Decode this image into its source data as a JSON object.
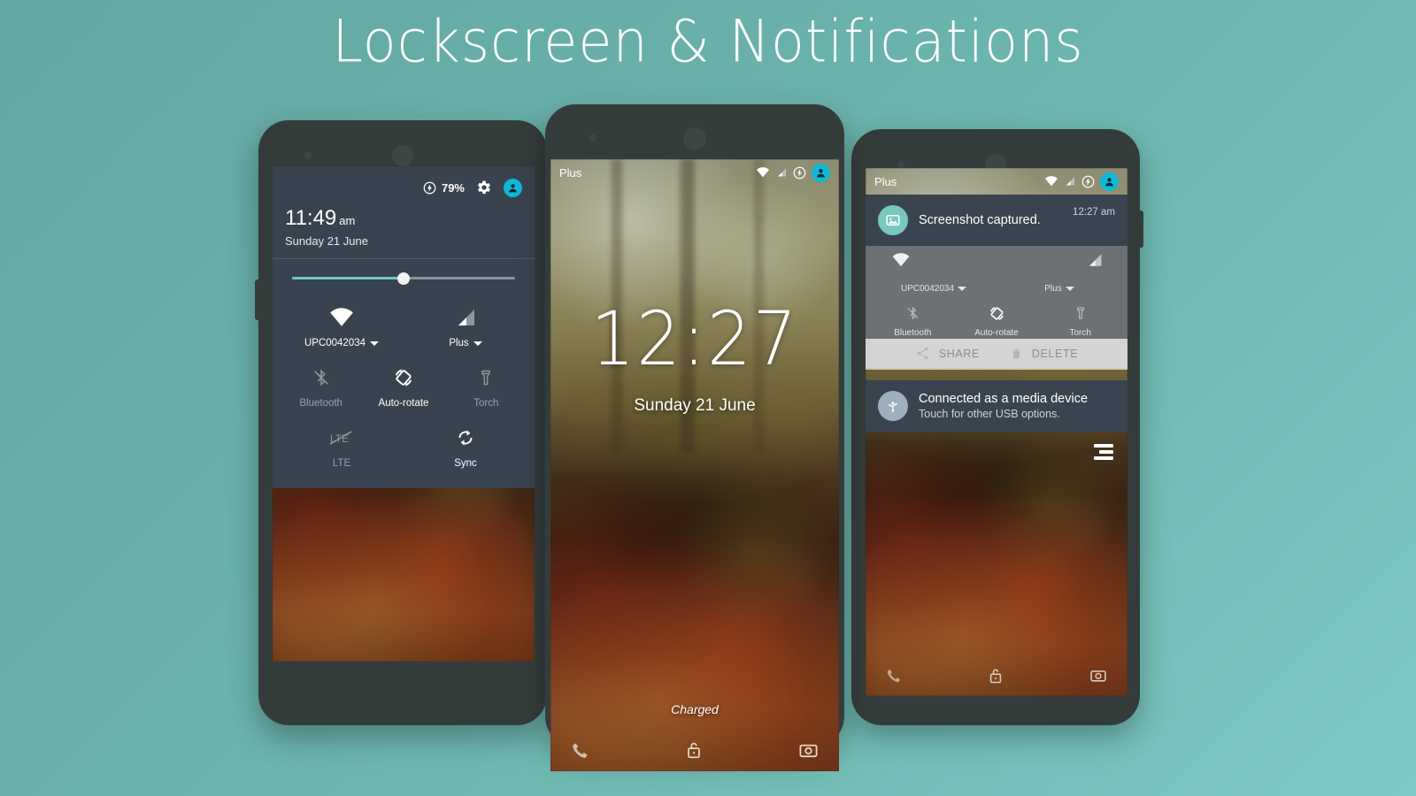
{
  "header": {
    "title": "Lockscreen & Notifications"
  },
  "theme": {
    "background_top": "#63a6a0",
    "background_bottom": "#7cc8c2",
    "panel": "#39434f",
    "accent_cyan": "#0fb9d7",
    "accent_teal": "#6fc9bd",
    "phone_body": "#343c3b"
  },
  "phone_left": {
    "name": "quick-settings-panel",
    "status": {
      "battery_percent": "79%",
      "battery_icon": "battery-charging-icon",
      "settings_icon": "gear-icon",
      "avatar_icon": "user-avatar-icon"
    },
    "clock": {
      "time": "11:49",
      "ampm": "am",
      "date": "Sunday 21 June"
    },
    "brightness": {
      "label": "brightness-slider",
      "value": 50
    },
    "tiles": [
      {
        "label": "UPC0042034",
        "icon": "wifi-icon",
        "has_caret": true,
        "state": "on"
      },
      {
        "label": "Plus",
        "icon": "signal-icon",
        "has_caret": true,
        "state": "on"
      },
      {
        "label": "Bluetooth",
        "icon": "bluetooth-off-icon",
        "has_caret": false,
        "state": "off"
      },
      {
        "label": "Auto-rotate",
        "icon": "auto-rotate-icon",
        "has_caret": false,
        "state": "on"
      },
      {
        "label": "Torch",
        "icon": "torch-icon",
        "has_caret": false,
        "state": "off"
      },
      {
        "label": "LTE",
        "icon": "lte-off-icon",
        "has_caret": false,
        "state": "off"
      },
      {
        "label": "Sync",
        "icon": "sync-icon",
        "has_caret": false,
        "state": "on"
      }
    ]
  },
  "phone_center": {
    "name": "lockscreen",
    "status": {
      "carrier": "Plus",
      "wifi_icon": "wifi-icon",
      "signal_icon": "signal-icon",
      "battery_icon": "battery-charging-icon",
      "avatar_icon": "user-avatar-icon"
    },
    "clock": {
      "time": "12:27",
      "date": "Sunday 21 June"
    },
    "battery_status": "Charged",
    "shortcuts": [
      {
        "label": "phone-shortcut",
        "icon": "phone-icon"
      },
      {
        "label": "unlock",
        "icon": "lock-open-icon"
      },
      {
        "label": "camera-shortcut",
        "icon": "camera-icon"
      }
    ]
  },
  "phone_right": {
    "name": "notification-shade",
    "status": {
      "carrier": "Plus",
      "wifi_icon": "wifi-icon",
      "signal_icon": "signal-icon",
      "battery_icon": "battery-charging-icon",
      "avatar_icon": "user-avatar-icon"
    },
    "notifications": [
      {
        "title": "Screenshot captured.",
        "subtitle": "",
        "time": "12:27 am",
        "icon": "image-icon",
        "icon_color": "#79c8bd"
      },
      {
        "title": "Connected as a media device",
        "subtitle": "Touch for other USB options.",
        "time": "",
        "icon": "usb-icon",
        "icon_color": "#9fb0bd"
      }
    ],
    "screenshot_preview": {
      "tiles": [
        {
          "label": "UPC0042034",
          "icon": "wifi-icon",
          "has_caret": true
        },
        {
          "label": "Plus",
          "icon": "signal-icon",
          "has_caret": true
        },
        {
          "label": "Bluetooth",
          "icon": "bluetooth-off-icon",
          "has_caret": false
        },
        {
          "label": "Auto-rotate",
          "icon": "auto-rotate-icon",
          "has_caret": false
        },
        {
          "label": "Torch",
          "icon": "torch-icon",
          "has_caret": false
        }
      ],
      "actions": [
        {
          "label": "SHARE",
          "icon": "share-icon"
        },
        {
          "label": "DELETE",
          "icon": "trash-icon"
        }
      ]
    },
    "clear_all_icon": "clear-all-icon"
  }
}
